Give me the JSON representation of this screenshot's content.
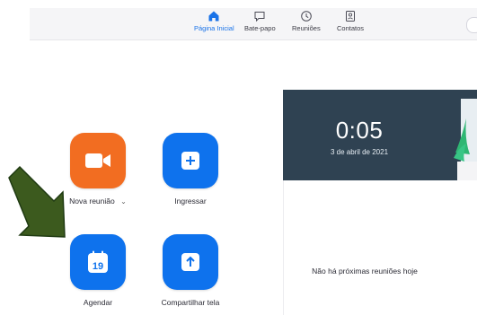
{
  "nav": {
    "items": [
      {
        "label": "Página Inicial",
        "icon": "home-icon",
        "active": true
      },
      {
        "label": "Bate-papo",
        "icon": "chat-icon",
        "active": false
      },
      {
        "label": "Reuniões",
        "icon": "clock-icon",
        "active": false
      },
      {
        "label": "Contatos",
        "icon": "contacts-icon",
        "active": false
      }
    ]
  },
  "actions": {
    "new_meeting": {
      "label": "Nova reunião",
      "dropdown": "⌄",
      "color": "#f26d21"
    },
    "join": {
      "label": "Ingressar",
      "color": "#0e72ed"
    },
    "schedule": {
      "label": "Agendar",
      "day": "19",
      "color": "#0e72ed"
    },
    "share_screen": {
      "label": "Compartilhar tela",
      "color": "#0e72ed"
    }
  },
  "clock_card": {
    "time": "0:05",
    "date": "3 de abril de 2021",
    "background": "#2f4252",
    "empty_message": "Não há próximas reuniões hoje"
  },
  "annotation": {
    "arrow_color": "#3c5a1e"
  }
}
